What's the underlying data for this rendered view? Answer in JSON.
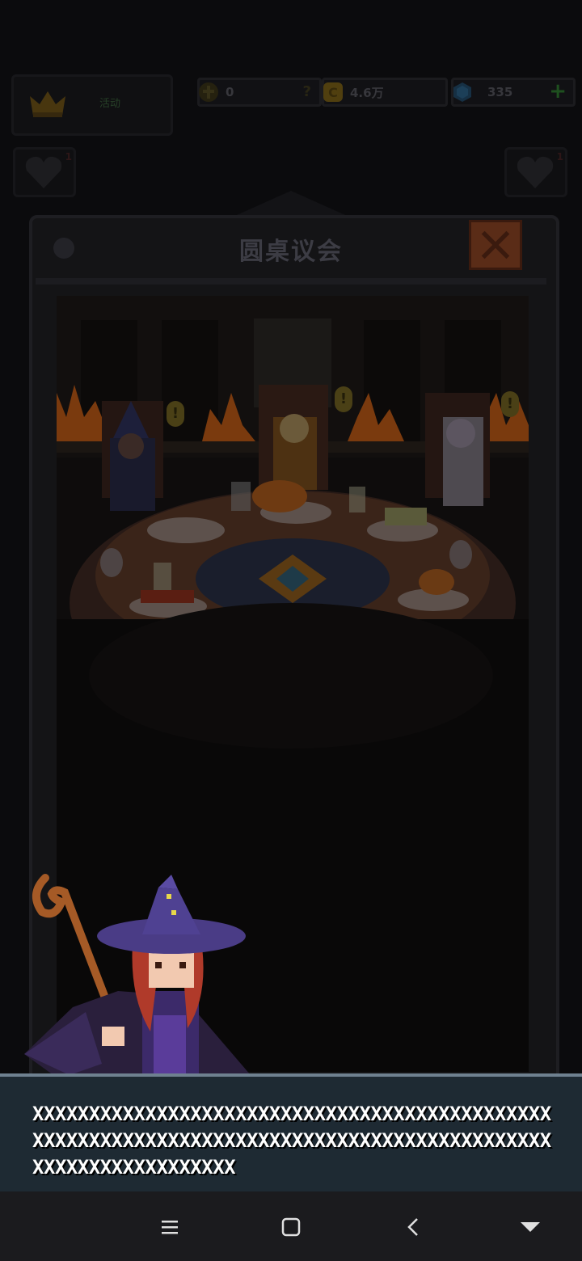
{
  "hud": {
    "crown_label": "活动",
    "badge_value": "0",
    "badge_help": "?",
    "gold_value": "4.6万",
    "gem_value": "335",
    "gem_plus": "+",
    "heart_left_count": "1",
    "heart_right_count": "1"
  },
  "modal": {
    "title": "圆桌议会",
    "alert_mark": "!"
  },
  "dialog": {
    "text": "XXXXXXXXXXXXXXXXXXXXXXXXXXXXXXXXXXXXXXXXXXXXXXXXXXXXXXXXXXXXXXXXXXXXXXXXXXXXXXXXXXXXXXXXXXXXXXXXXXXXXXXXXXXXXX"
  },
  "colors": {
    "dialog_bg": "#1e2a33",
    "close_button": "#5a2c17",
    "fire": "#a04a12",
    "witch_hat": "#4a3c86"
  }
}
